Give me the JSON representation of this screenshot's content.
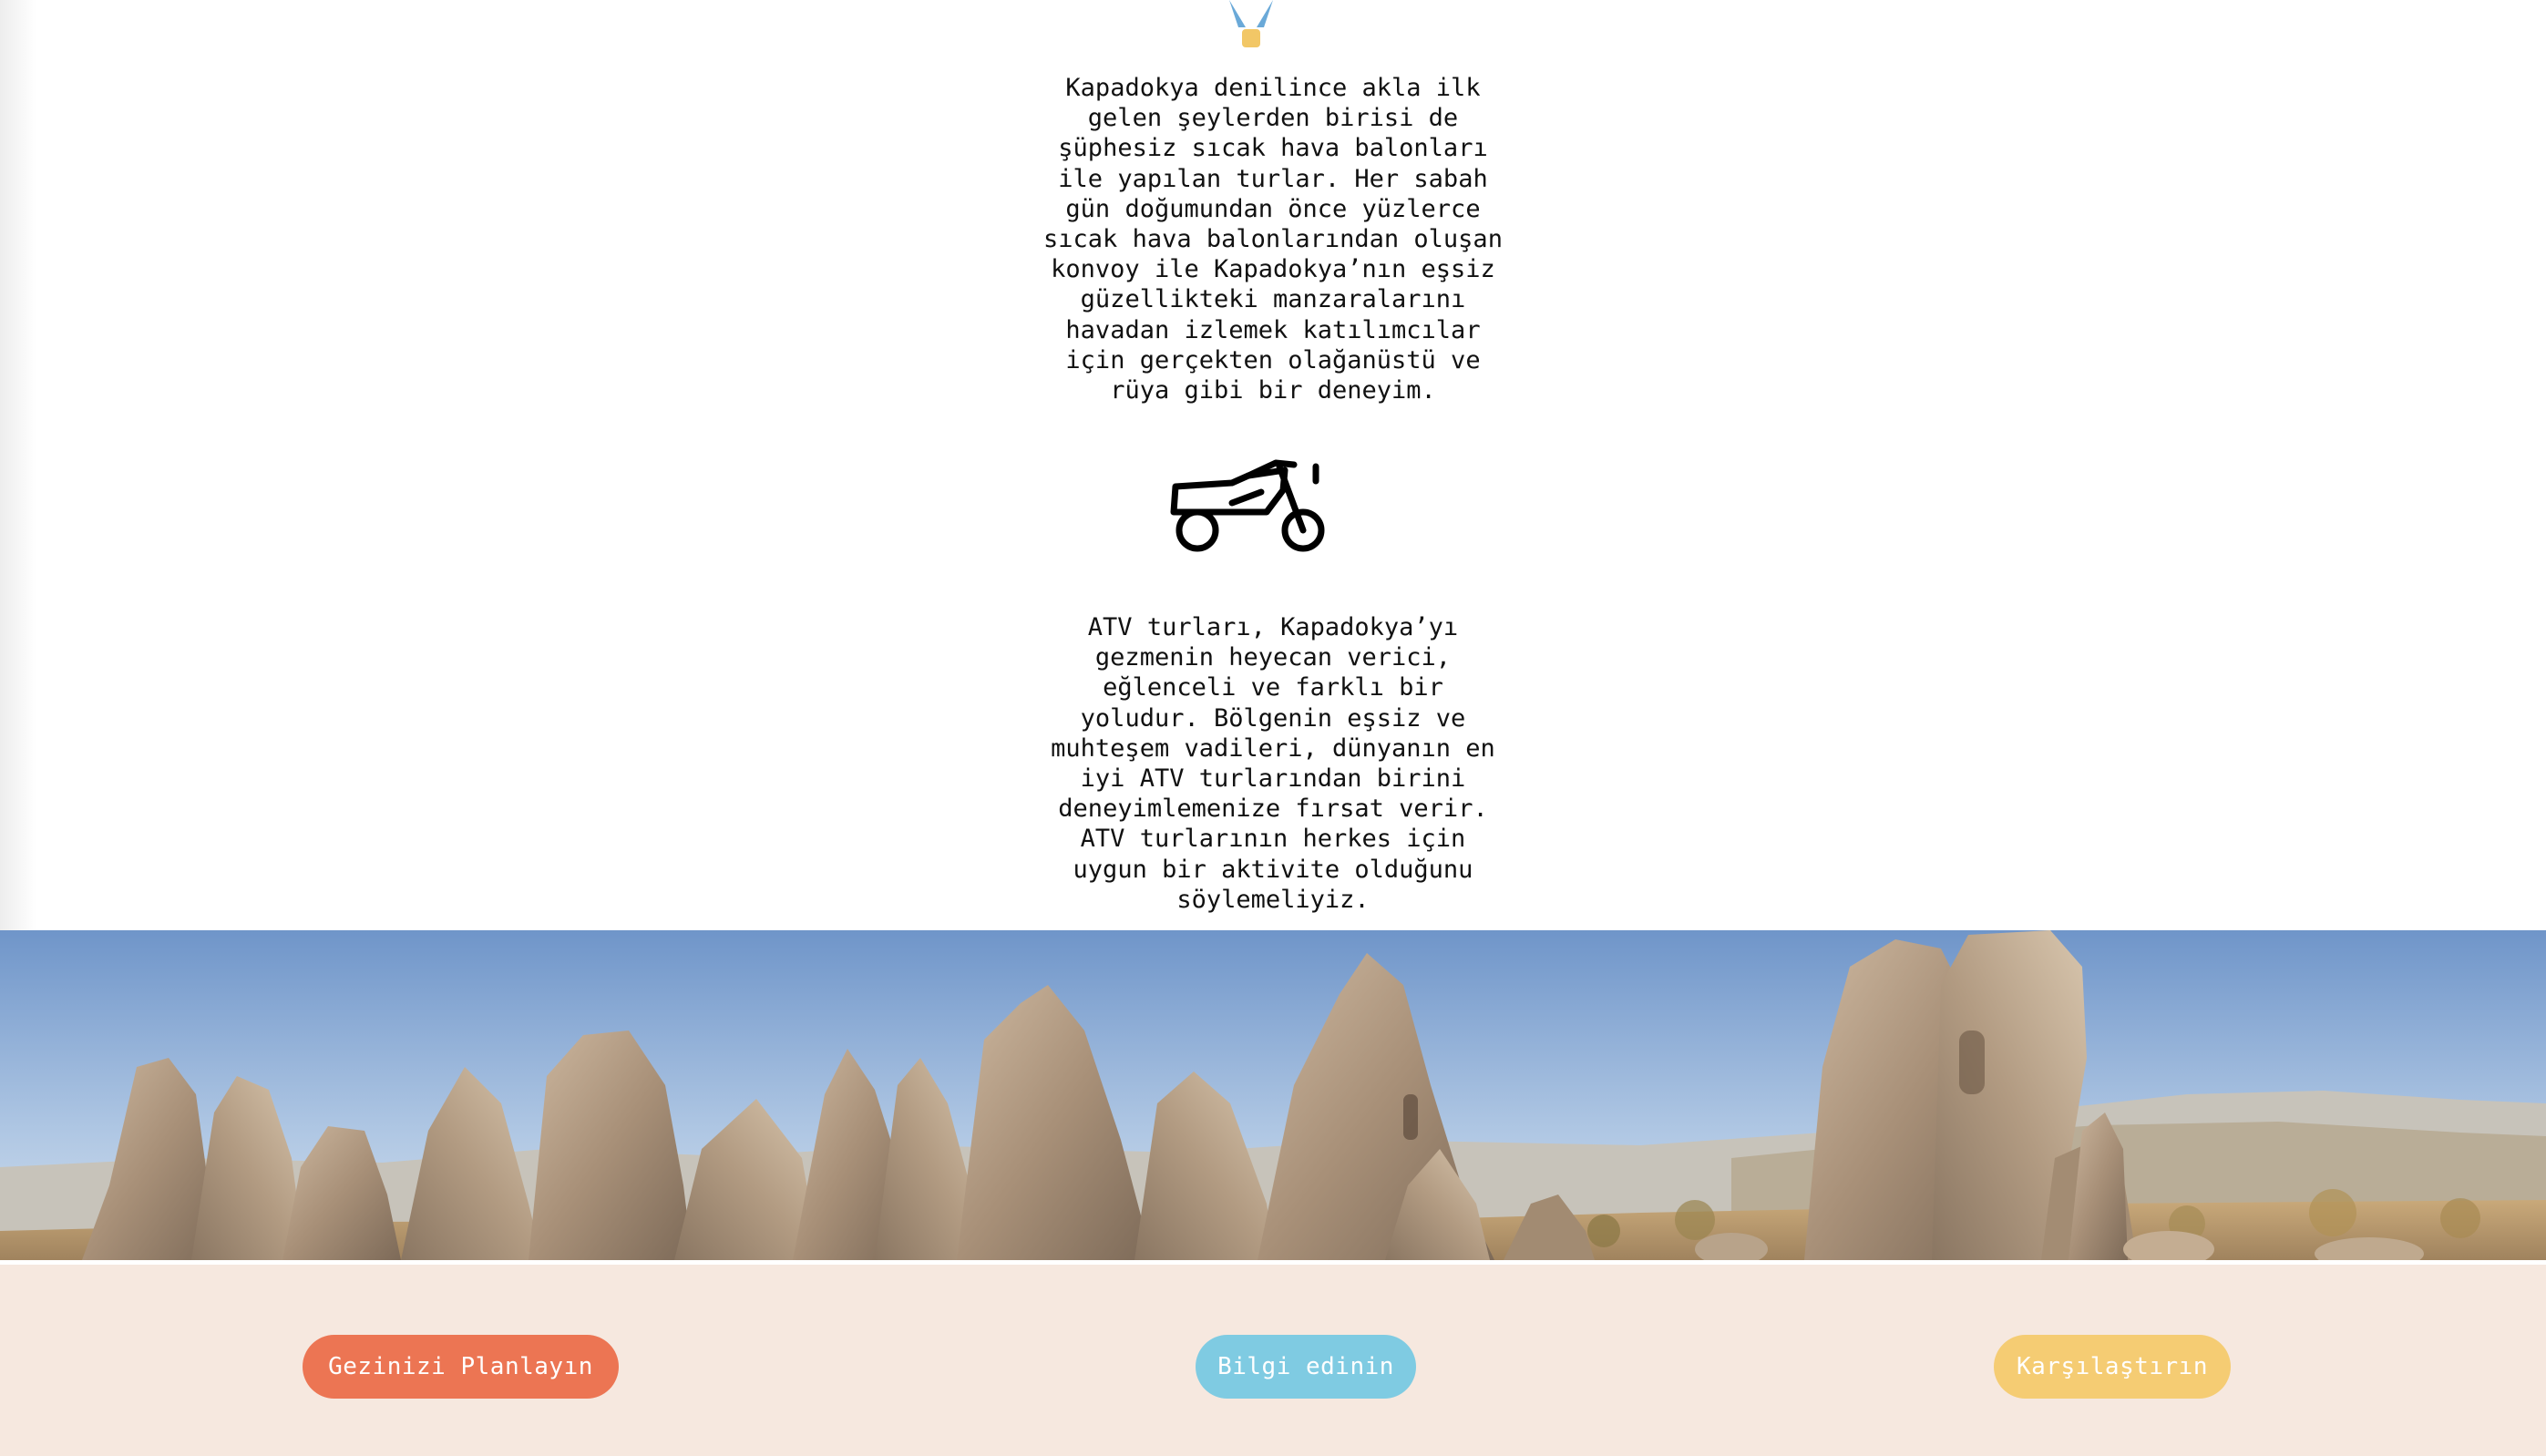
{
  "content": {
    "balloon_icon": "hot-air-balloon-icon",
    "balloon_text": "Kapadokya denilince akla ilk\ngelen şeylerden birisi de\nşüphesiz sıcak hava balonları\nile yapılan turlar. Her sabah\ngün doğumundan önce yüzlerce\nsıcak hava balonlarından oluşan\nkonvoy ile Kapadokya’nın eşsiz\ngüzellikteki manzaralarını\nhavadan izlemek katılımcılar\niçin gerçekten olağanüstü ve\nrüya gibi bir deneyim.",
    "atv_icon": "motorcycle-atv-icon",
    "atv_text": "ATV turları, Kapadokya’yı\ngezmenin heyecan verici,\neğlenceli ve farklı bir\nyoludur. Bölgenin eşsiz ve\nmuhteşem vadileri, dünyanın en\niyi ATV turlarından birini\ndeneyimlemenize fırsat verir.\nATV turlarının herkes için\nuygun bir aktivite olduğunu\nsöylemeliyiz."
  },
  "banner": {
    "image": "cappadocia-fairy-chimneys-landscape"
  },
  "footer": {
    "buttons": [
      {
        "label": "Gezinizi Planlayın",
        "color": "#ec7553"
      },
      {
        "label": "Bilgi edinin",
        "color": "#7fcbe2"
      },
      {
        "label": "Karşılaştırın",
        "color": "#f5cc73"
      }
    ],
    "background": "#f6e8df"
  }
}
